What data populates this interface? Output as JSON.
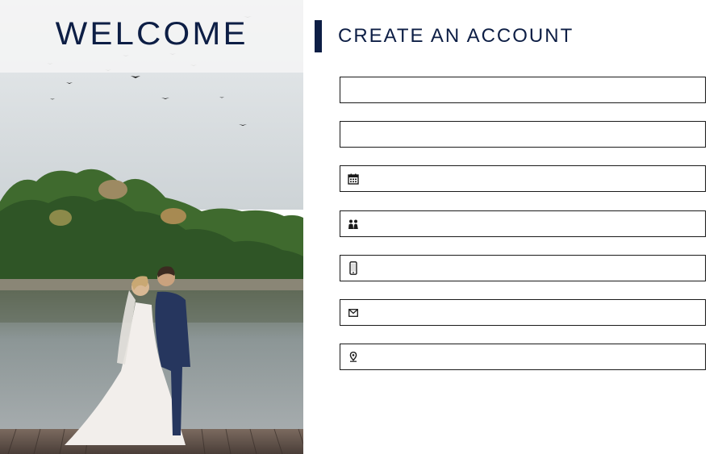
{
  "left_panel": {
    "title": "WELCOME",
    "photo_alt": "Bride and groom embracing on a lakeside pier"
  },
  "form": {
    "title": "CREATE AN ACCOUNT",
    "fields": [
      {
        "name": "field-1",
        "icon": "none",
        "value": "",
        "placeholder": ""
      },
      {
        "name": "field-2",
        "icon": "none",
        "value": "",
        "placeholder": ""
      },
      {
        "name": "date-field",
        "icon": "calendar-icon",
        "value": "",
        "placeholder": ""
      },
      {
        "name": "couple-field",
        "icon": "couple-icon",
        "value": "",
        "placeholder": ""
      },
      {
        "name": "phone-field",
        "icon": "phone-icon",
        "value": "",
        "placeholder": ""
      },
      {
        "name": "email-field",
        "icon": "envelope-icon",
        "value": "",
        "placeholder": ""
      },
      {
        "name": "location-field",
        "icon": "map-pin-icon",
        "value": "",
        "placeholder": ""
      }
    ]
  },
  "colors": {
    "accent": "#0d1e45",
    "field_border": "#1a1a1a",
    "background": "#ffffff"
  }
}
